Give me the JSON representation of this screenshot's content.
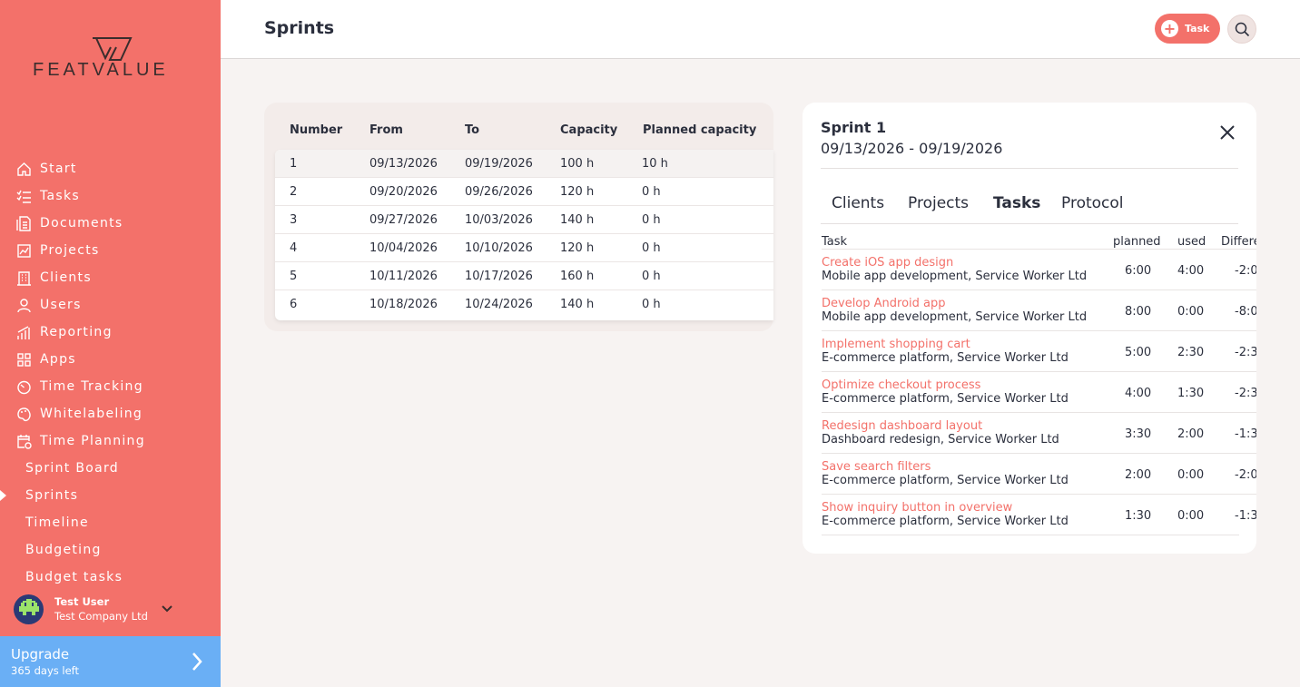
{
  "app": {
    "logo_text": "FEATVALUE",
    "accent": "#f3716a",
    "upgrade_color": "#6aaff5"
  },
  "sidebar": {
    "items": [
      {
        "label": "Start",
        "icon": "home-icon"
      },
      {
        "label": "Tasks",
        "icon": "tasks-icon"
      },
      {
        "label": "Documents",
        "icon": "documents-icon"
      },
      {
        "label": "Projects",
        "icon": "projects-icon"
      },
      {
        "label": "Clients",
        "icon": "clients-icon"
      },
      {
        "label": "Users",
        "icon": "user-icon"
      },
      {
        "label": "Reporting",
        "icon": "reporting-icon"
      },
      {
        "label": "Apps",
        "icon": "apps-icon"
      },
      {
        "label": "Time Tracking",
        "icon": "stopwatch-icon"
      },
      {
        "label": "Whitelabeling",
        "icon": "palette-icon"
      },
      {
        "label": "Time Planning",
        "icon": "calendar-clock-icon"
      }
    ],
    "subitems": [
      {
        "label": "Sprint Board"
      },
      {
        "label": "Sprints",
        "active": true
      },
      {
        "label": "Timeline"
      },
      {
        "label": "Budgeting"
      },
      {
        "label": "Budget tasks"
      }
    ],
    "user": {
      "name": "Test User",
      "company": "Test Company Ltd"
    },
    "upgrade": {
      "title": "Upgrade",
      "subtitle": "365 days left"
    }
  },
  "header": {
    "title": "Sprints",
    "task_button": "Task"
  },
  "sprints": {
    "columns": [
      "Number",
      "From",
      "To",
      "Capacity",
      "Planned capacity"
    ],
    "rows": [
      [
        "1",
        "09/13/2026",
        "09/19/2026",
        "100 h",
        "10 h"
      ],
      [
        "2",
        "09/20/2026",
        "09/26/2026",
        "120 h",
        "0 h"
      ],
      [
        "3",
        "09/27/2026",
        "10/03/2026",
        "140 h",
        "0 h"
      ],
      [
        "4",
        "10/04/2026",
        "10/10/2026",
        "120 h",
        "0 h"
      ],
      [
        "5",
        "10/11/2026",
        "10/17/2026",
        "160 h",
        "0 h"
      ],
      [
        "6",
        "10/18/2026",
        "10/24/2026",
        "140 h",
        "0 h"
      ]
    ]
  },
  "detail": {
    "title": "Sprint 1",
    "range": "09/13/2026 - 09/19/2026",
    "tabs": [
      {
        "label": "Clients"
      },
      {
        "label": "Projects"
      },
      {
        "label": "Tasks",
        "active": true
      },
      {
        "label": "Protocol"
      }
    ],
    "columns": [
      "Task",
      "planned",
      "used",
      "Differe"
    ],
    "tasks": [
      {
        "name": "Create iOS app design",
        "meta": "Mobile app development, Service Worker Ltd",
        "planned": "6:00",
        "used": "4:00",
        "diff": "-2:0"
      },
      {
        "name": "Develop Android app",
        "meta": "Mobile app development, Service Worker Ltd",
        "planned": "8:00",
        "used": "0:00",
        "diff": "-8:0"
      },
      {
        "name": "Implement shopping cart",
        "meta": "E-commerce platform, Service Worker Ltd",
        "planned": "5:00",
        "used": "2:30",
        "diff": "-2:3"
      },
      {
        "name": "Optimize checkout process",
        "meta": "E-commerce platform, Service Worker Ltd",
        "planned": "4:00",
        "used": "1:30",
        "diff": "-2:3"
      },
      {
        "name": "Redesign dashboard layout",
        "meta": "Dashboard redesign, Service Worker Ltd",
        "planned": "3:30",
        "used": "2:00",
        "diff": "-1:3"
      },
      {
        "name": "Save search filters",
        "meta": "E-commerce platform, Service Worker Ltd",
        "planned": "2:00",
        "used": "0:00",
        "diff": "-2:0"
      },
      {
        "name": "Show inquiry button in overview",
        "meta": "E-commerce platform, Service Worker Ltd",
        "planned": "1:30",
        "used": "0:00",
        "diff": "-1:3"
      }
    ]
  }
}
